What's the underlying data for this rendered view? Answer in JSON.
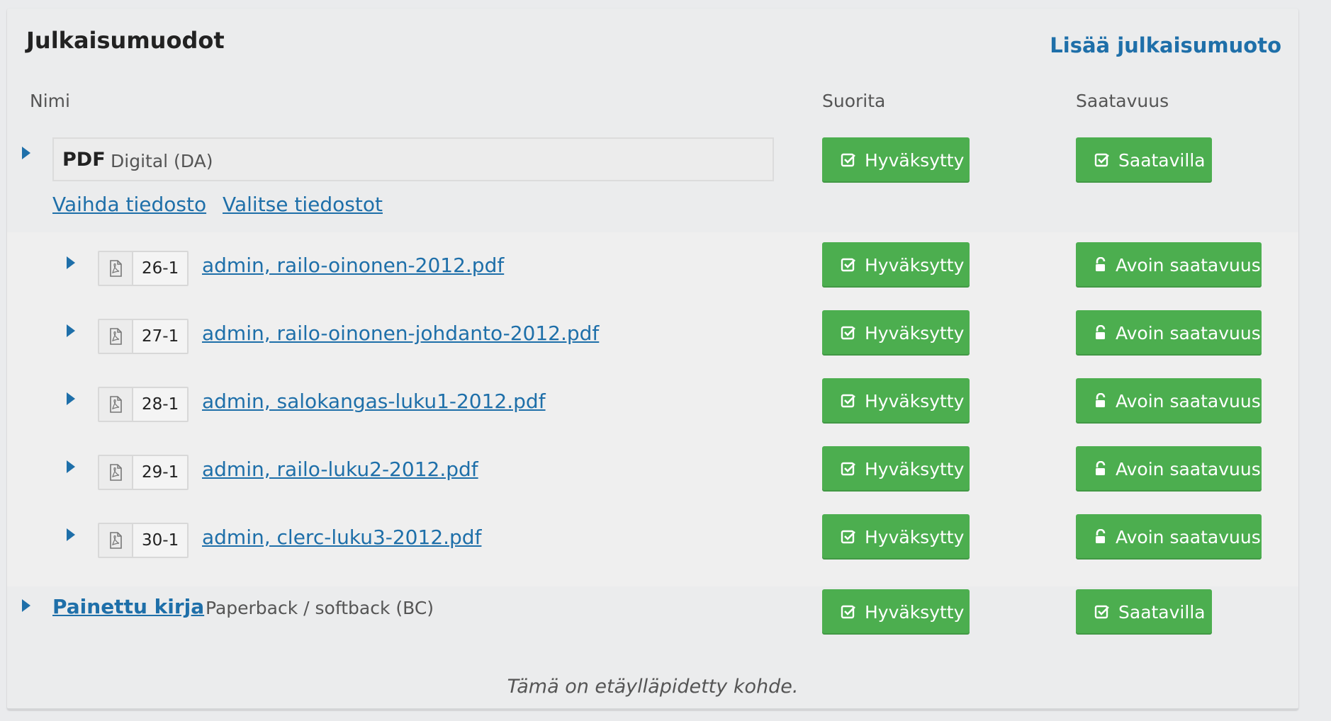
{
  "header": {
    "title": "Julkaisumuodot",
    "add_link": "Lisää julkaisumuoto"
  },
  "columns": {
    "name": "Nimi",
    "action": "Suorita",
    "availability": "Saatavuus"
  },
  "pdf_format": {
    "name": "PDF",
    "type": "Digital (DA)",
    "approve": "Hyväksytty",
    "availability": "Saatavilla",
    "links": {
      "change_file": "Vaihda tiedosto",
      "select_files": "Valitse tiedostot"
    }
  },
  "files": [
    {
      "id": "26-1",
      "name": "admin, railo-oinonen-2012.pdf",
      "approve": "Hyväksytty",
      "availability": "Avoin saatavuus"
    },
    {
      "id": "27-1",
      "name": "admin, railo-oinonen-johdanto-2012.pdf",
      "approve": "Hyväksytty",
      "availability": "Avoin saatavuus"
    },
    {
      "id": "28-1",
      "name": "admin, salokangas-luku1-2012.pdf",
      "approve": "Hyväksytty",
      "availability": "Avoin saatavuus"
    },
    {
      "id": "29-1",
      "name": "admin, railo-luku2-2012.pdf",
      "approve": "Hyväksytty",
      "availability": "Avoin saatavuus"
    },
    {
      "id": "30-1",
      "name": "admin, clerc-luku3-2012.pdf",
      "approve": "Hyväksytty",
      "availability": "Avoin saatavuus"
    }
  ],
  "print_format": {
    "name": "Painettu kirja",
    "type": "Paperback / softback (BC)",
    "approve": "Hyväksytty",
    "availability": "Saatavilla"
  },
  "footer_note": "Tämä on etäylläpidetty kohde.",
  "colors": {
    "accent": "#1e6fa9",
    "success": "#4cae4f",
    "background": "#ebeced"
  }
}
